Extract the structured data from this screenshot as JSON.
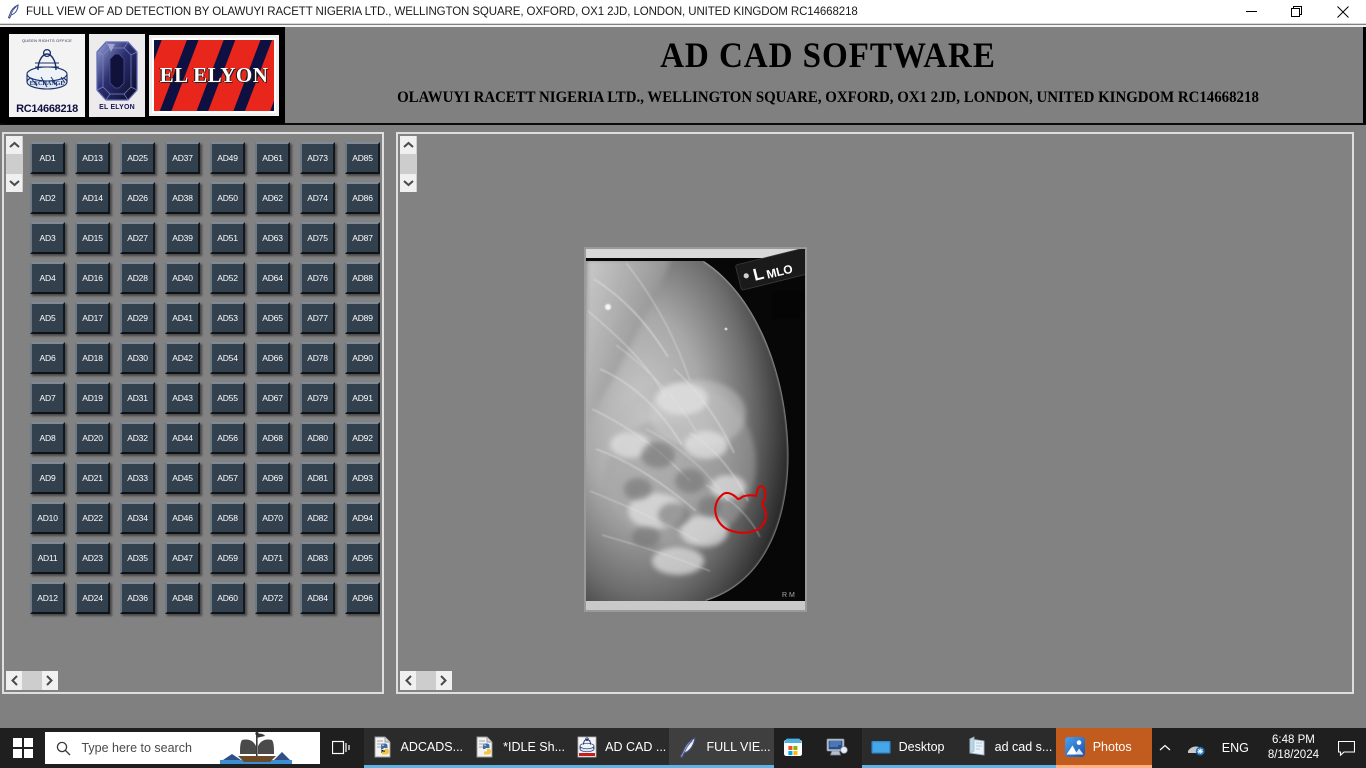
{
  "window": {
    "title": "FULL VIEW OF AD DETECTION BY OLAWUYI RACETT NIGERIA LTD., WELLINGTON SQUARE, OXFORD, OX1 2JD, LONDON, UNITED KINGDOM RC14668218",
    "app_icon": "feather-quill-icon",
    "controls": {
      "minimize": "minimize-icon",
      "restore": "restore-icon",
      "close": "close-icon"
    }
  },
  "header": {
    "title": "AD CAD SOFTWARE",
    "subtitle": "OLAWUYI RACETT NIGERIA LTD., WELLINGTON SQUARE, OXFORD, OX1 2JD, LONDON, UNITED KINGDOM RC14668218",
    "logos": {
      "seal": {
        "top_text": "QUEEN RIGHTS OFFICE",
        "reg_number": "RC14668218",
        "icon": "company-seal-icon"
      },
      "gem": {
        "label": "EL ELYON",
        "icon": "gemstone-icon"
      },
      "banner": {
        "text": "EL ELYON",
        "icon": "el-elyon-banner-icon",
        "stripe_color": "#e8261c",
        "bg_color": "#0d1040"
      }
    }
  },
  "left_panel": {
    "buttons": [
      "AD1",
      "AD2",
      "AD3",
      "AD4",
      "AD5",
      "AD6",
      "AD7",
      "AD8",
      "AD9",
      "AD10",
      "AD11",
      "AD12",
      "AD13",
      "AD14",
      "AD15",
      "AD16",
      "AD17",
      "AD18",
      "AD19",
      "AD20",
      "AD21",
      "AD22",
      "AD23",
      "AD24",
      "AD25",
      "AD26",
      "AD27",
      "AD28",
      "AD29",
      "AD30",
      "AD31",
      "AD32",
      "AD33",
      "AD34",
      "AD35",
      "AD36",
      "AD37",
      "AD38",
      "AD39",
      "AD40",
      "AD41",
      "AD42",
      "AD43",
      "AD44",
      "AD45",
      "AD46",
      "AD47",
      "AD48",
      "AD49",
      "AD50",
      "AD51",
      "AD52",
      "AD53",
      "AD54",
      "AD55",
      "AD56",
      "AD57",
      "AD58",
      "AD59",
      "AD60",
      "AD61",
      "AD62",
      "AD63",
      "AD64",
      "AD65",
      "AD66",
      "AD67",
      "AD68",
      "AD69",
      "AD70",
      "AD71",
      "AD72",
      "AD73",
      "AD74",
      "AD75",
      "AD76",
      "AD77",
      "AD78",
      "AD79",
      "AD80",
      "AD81",
      "AD82",
      "AD83",
      "AD84",
      "AD85",
      "AD86",
      "AD87",
      "AD88",
      "AD89",
      "AD90",
      "AD91",
      "AD92",
      "AD93",
      "AD94",
      "AD95",
      "AD96"
    ],
    "columns": 8,
    "rows": 12,
    "button_color": "#33414f",
    "button_text_color": "#ffffff",
    "scrollbar": {
      "up": "chevron-up-icon",
      "down": "chevron-down-icon",
      "left": "chevron-left-icon",
      "right": "chevron-right-icon"
    }
  },
  "right_panel": {
    "image": {
      "name": "mammogram-l-mlo",
      "marker_label": "L MLO",
      "annotation_color": "#e00000",
      "annotation_name": "lesion-outline"
    },
    "scrollbar": {
      "up": "chevron-up-icon",
      "down": "chevron-down-icon",
      "left": "chevron-left-icon",
      "right": "chevron-right-icon"
    }
  },
  "taskbar": {
    "start": "windows-start-icon",
    "search": {
      "placeholder": "Type here to search",
      "icon": "search-icon",
      "decoration": "sailing-ship-icon"
    },
    "task_view": "task-view-icon",
    "apps": [
      {
        "label": "ADCADS...",
        "icon": "python-file-icon",
        "state": "open"
      },
      {
        "label": "*IDLE Sh...",
        "icon": "python-file-icon",
        "state": "open"
      },
      {
        "label": "AD CAD ...",
        "icon": "seal-app-icon",
        "state": "open"
      },
      {
        "label": "FULL VIE...",
        "icon": "feather-quill-icon",
        "state": "active"
      },
      {
        "label": "",
        "icon": "microsoft-store-icon",
        "state": "pinned"
      },
      {
        "label": "",
        "icon": "remote-desktop-icon",
        "state": "pinned"
      },
      {
        "label": "Desktop",
        "icon": "desktop-monitor-icon",
        "state": "open"
      },
      {
        "label": "ad cad s...",
        "icon": "notepad-icon",
        "state": "open"
      },
      {
        "label": "Photos",
        "icon": "photos-icon",
        "state": "photos"
      }
    ],
    "tray": {
      "overflow": "chevron-up-icon",
      "network": "network-icon",
      "language": "ENG",
      "time": "6:48 PM",
      "date": "8/18/2024",
      "action_center": "action-center-icon"
    }
  }
}
